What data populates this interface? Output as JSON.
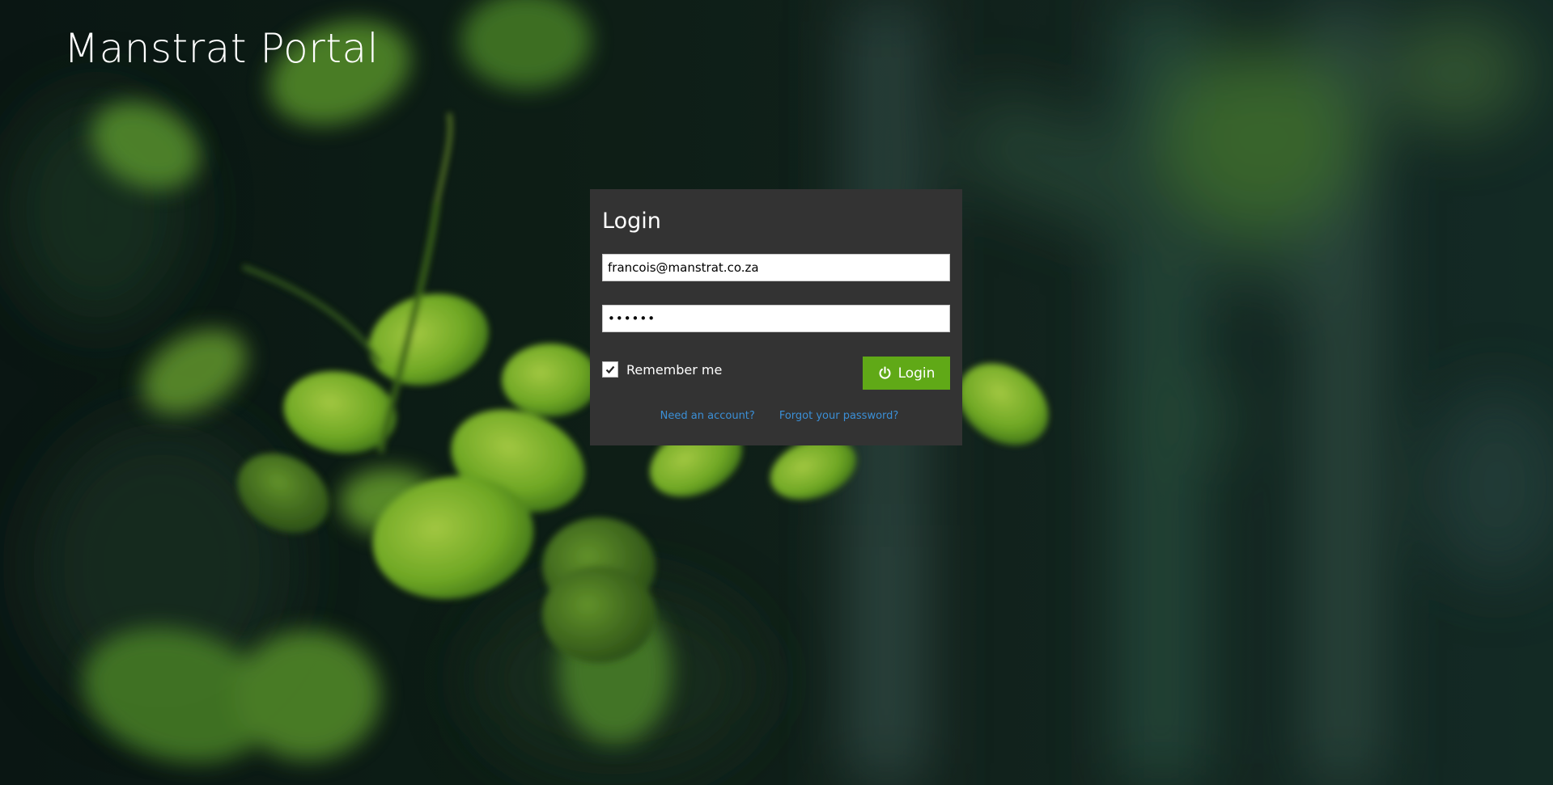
{
  "app": {
    "title": "Manstrat Portal"
  },
  "login": {
    "heading": "Login",
    "email_value": "francois@manstrat.co.za",
    "password_value": "••••••",
    "remember_label": "Remember me",
    "remember_checked": true,
    "login_button_label": "Login",
    "need_account_link": "Need an account?",
    "forgot_password_link": "Forgot your password?"
  },
  "icons": {
    "power": "power-icon",
    "check": "checkmark-icon"
  },
  "colors": {
    "panel_background": "#333333",
    "login_button": "#60a917",
    "link": "#3b8fd6",
    "title_text": "#ffffff"
  },
  "background": {
    "image": "blurred-green-leaves-photo"
  }
}
